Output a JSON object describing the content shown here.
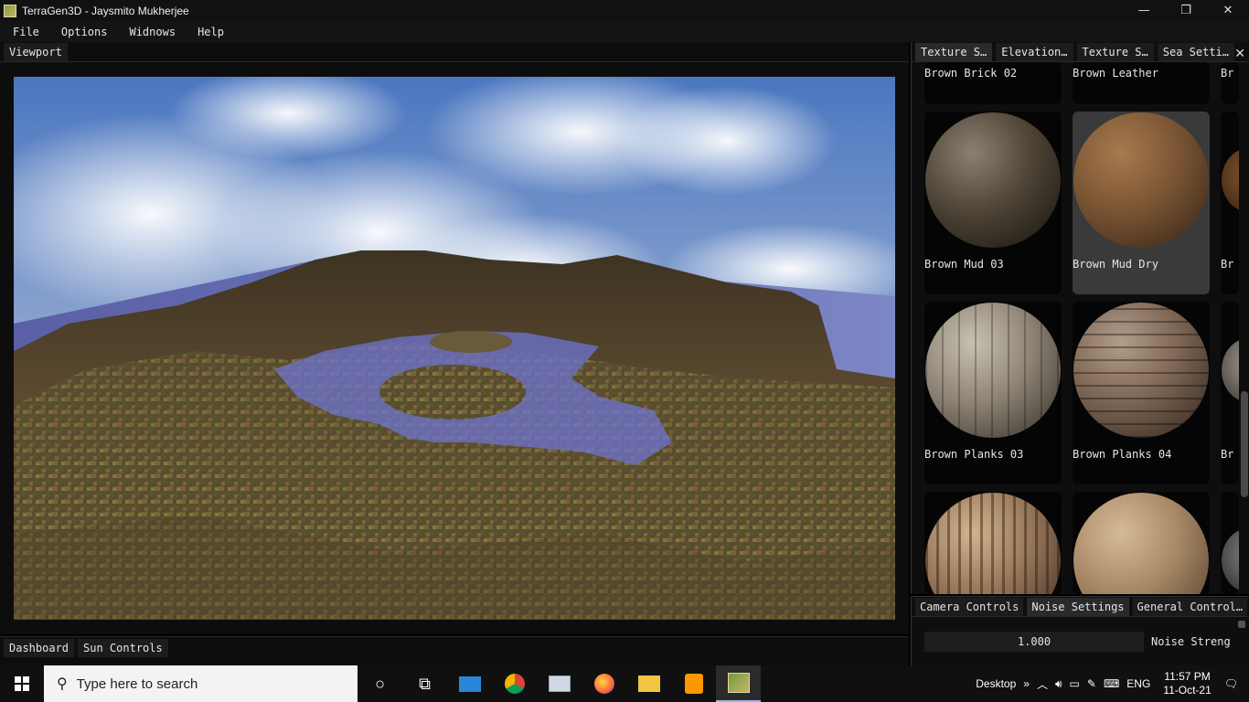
{
  "window": {
    "title": "TerraGen3D - Jaysmito Mukherjee",
    "minimize_icon": "—",
    "restore_icon": "❐",
    "close_icon": "✕"
  },
  "menu": {
    "items": [
      "File",
      "Options",
      "Widnows",
      "Help"
    ]
  },
  "viewport": {
    "tab_label": "Viewport"
  },
  "texture_panel": {
    "tabs": [
      "Texture S…",
      "Elevation…",
      "Texture S…",
      "Sea Setti…"
    ],
    "close_icon": "✕",
    "tiles": [
      {
        "label": "Brown Brick 02"
      },
      {
        "label": "Brown Leather"
      },
      {
        "label": "Br"
      },
      {
        "label": "Brown Mud 03"
      },
      {
        "label": "Brown Mud Dry"
      },
      {
        "label": "Br"
      },
      {
        "label": "Brown Planks 03"
      },
      {
        "label": "Brown Planks 04"
      },
      {
        "label": "Br"
      }
    ],
    "selected_tile": "Brown Mud Dry"
  },
  "controls_panel": {
    "tabs": [
      "Camera Controls",
      "Noise Settings",
      "General Control…"
    ],
    "noise_strength_value": "1.000",
    "noise_strength_label": "Noise Streng"
  },
  "dashboard": {
    "tabs": [
      "Dashboard",
      "Sun Controls"
    ]
  },
  "taskbar": {
    "search_placeholder": "Type here to search",
    "desktop_label": "Desktop",
    "chevron": "»",
    "language": "ENG",
    "time": "11:57 PM",
    "date": "11-Oct-21",
    "icons": [
      "windows-start-icon",
      "cortana-icon",
      "task-view-icon",
      "mail-icon",
      "chrome-icon",
      "photos-icon",
      "firefox-icon",
      "file-explorer-icon",
      "sublime-text-icon",
      "terragen-icon"
    ]
  },
  "colors": {
    "accent_selected_tile": "#3a3a3a",
    "panel_bg": "#0e0e0e",
    "tab_bg": "#1c1c1c"
  }
}
